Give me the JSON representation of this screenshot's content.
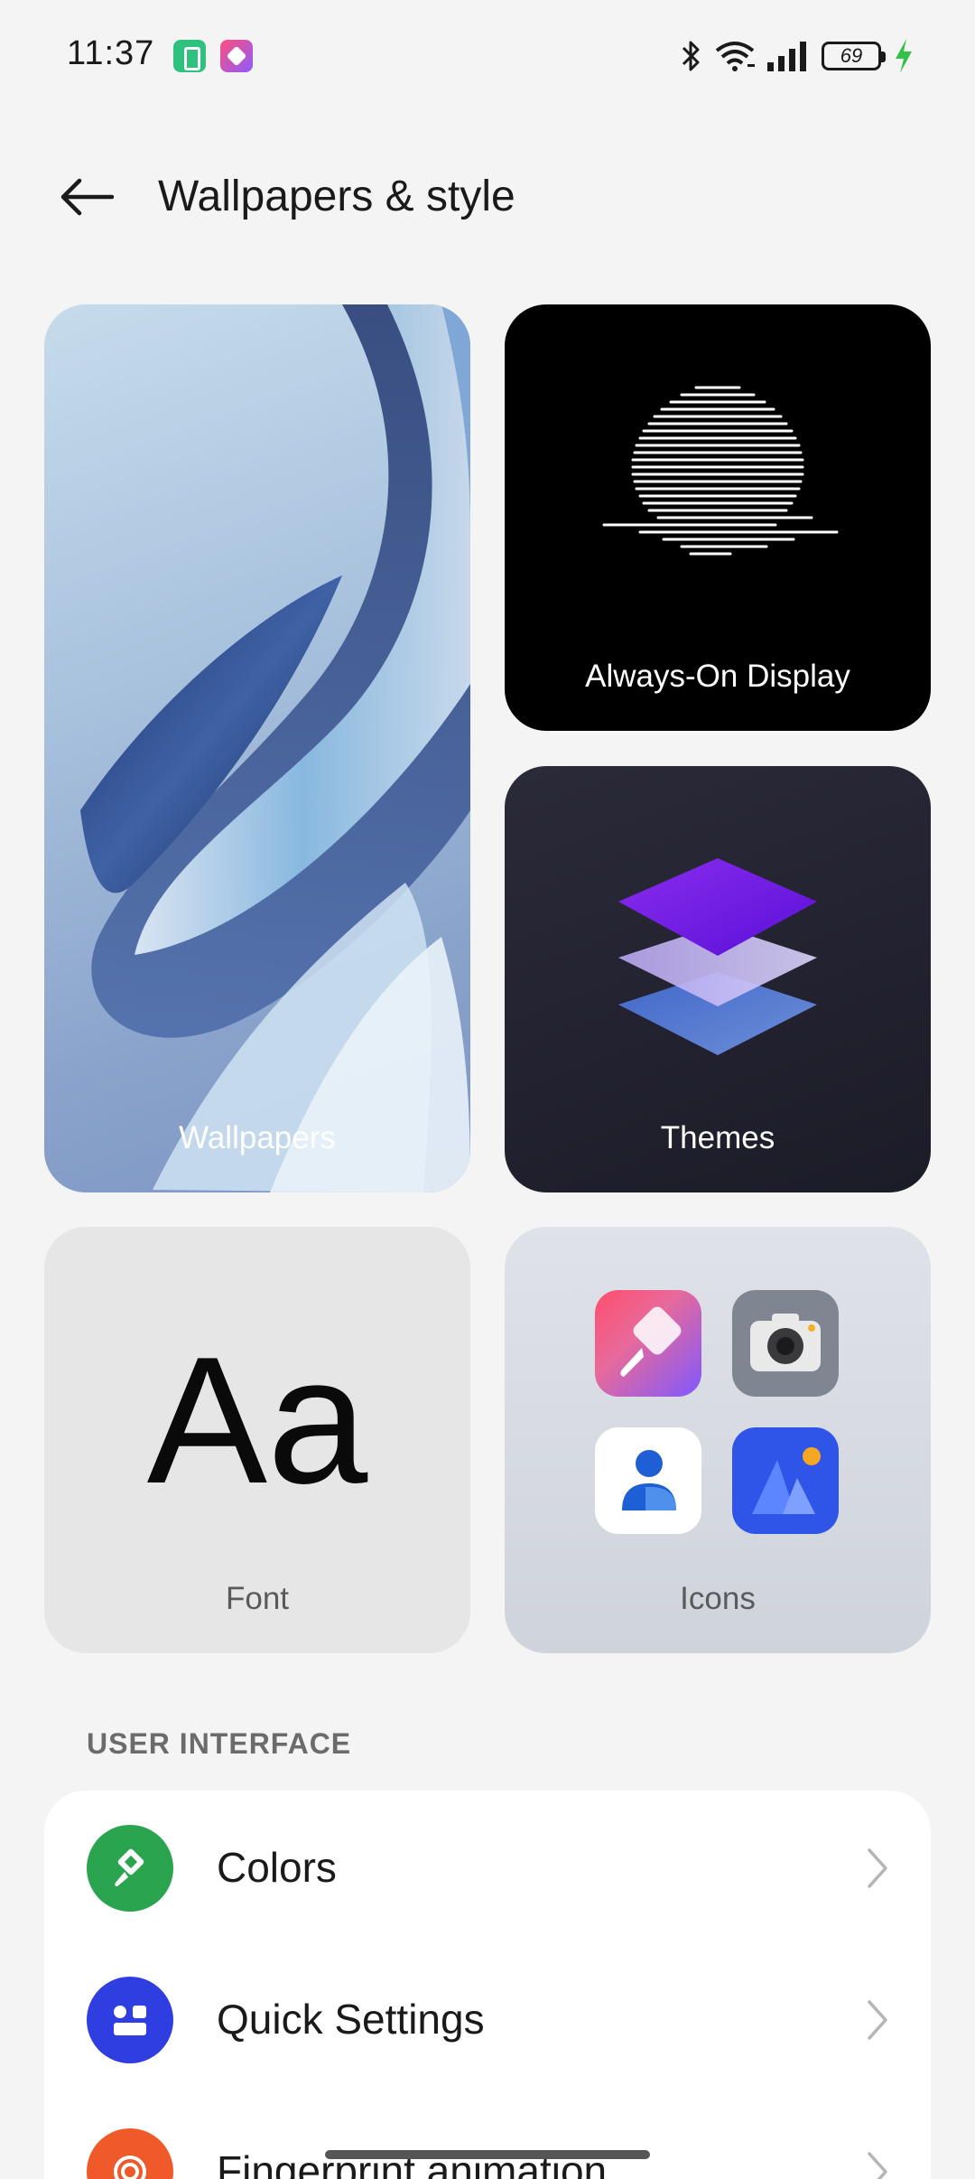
{
  "status_bar": {
    "time": "11:37",
    "battery_level": "69",
    "icons": [
      "battery-saver-icon",
      "theme-store-icon",
      "bluetooth-icon",
      "wifi-icon",
      "signal-icon",
      "battery-icon",
      "charging-icon"
    ]
  },
  "header": {
    "title": "Wallpapers & style",
    "back_icon": "back-arrow-icon"
  },
  "cards": {
    "wallpapers": "Wallpapers",
    "always_on_display": "Always-On Display",
    "themes": "Themes",
    "font": "Font",
    "font_sample": "Aa",
    "icons": "Icons"
  },
  "section": {
    "title": "USER INTERFACE"
  },
  "settings": [
    {
      "label": "Colors",
      "icon": "paint-bucket-icon",
      "color": "#2aa44f"
    },
    {
      "label": "Quick Settings",
      "icon": "quick-settings-icon",
      "color": "#2e3ee0"
    },
    {
      "label": "Fingerprint animation",
      "icon": "fingerprint-icon",
      "color": "#f05a2a"
    }
  ]
}
